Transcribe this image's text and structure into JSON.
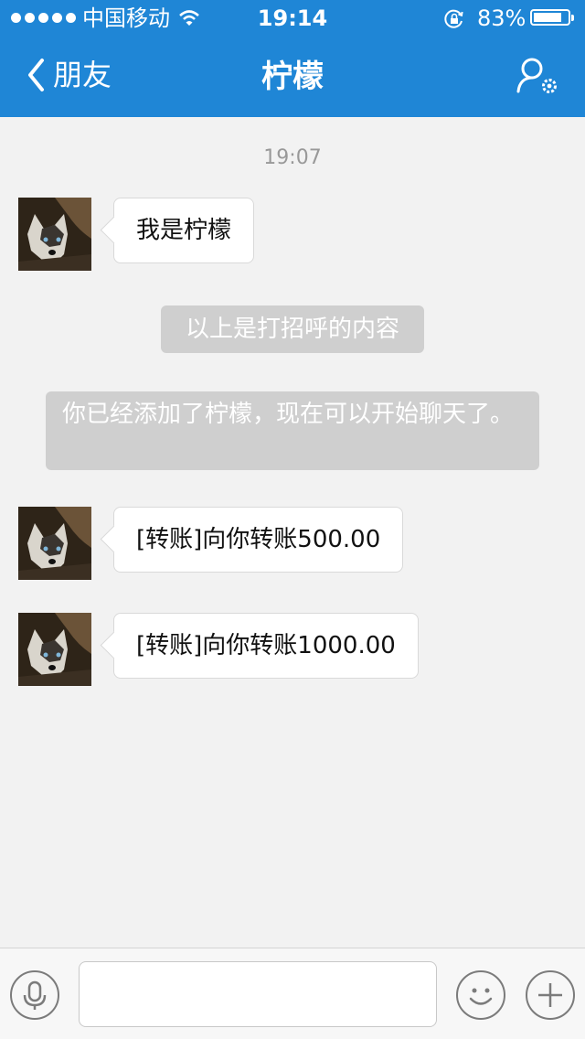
{
  "status_bar": {
    "carrier": "中国移动",
    "time": "19:14",
    "battery_percent": "83%",
    "battery_level": 0.83,
    "icons": [
      "signal-dots-icon",
      "wifi-icon",
      "orientation-lock-icon",
      "battery-icon"
    ]
  },
  "nav": {
    "back_label": "朋友",
    "title": "柠檬",
    "back_icon": "chevron-left-icon",
    "profile_icon": "profile-settings-icon"
  },
  "chat": {
    "timestamp": "19:07",
    "messages": [
      {
        "text": "我是柠檬"
      },
      {
        "text": "[转账]向你转账500.00"
      },
      {
        "text": "[转账]向你转账1000.00"
      }
    ],
    "system_notices": [
      {
        "text": "以上是打招呼的内容"
      },
      {
        "text": "你已经添加了柠檬，现在可以开始聊天了。"
      }
    ]
  },
  "input_bar": {
    "voice_icon": "microphone-icon",
    "input_value": "",
    "emoji_icon": "smiley-icon",
    "add_icon": "plus-icon"
  },
  "colors": {
    "header": "#1f86d6",
    "background": "#f2f2f2",
    "system_notice": "#cfcfcf"
  }
}
